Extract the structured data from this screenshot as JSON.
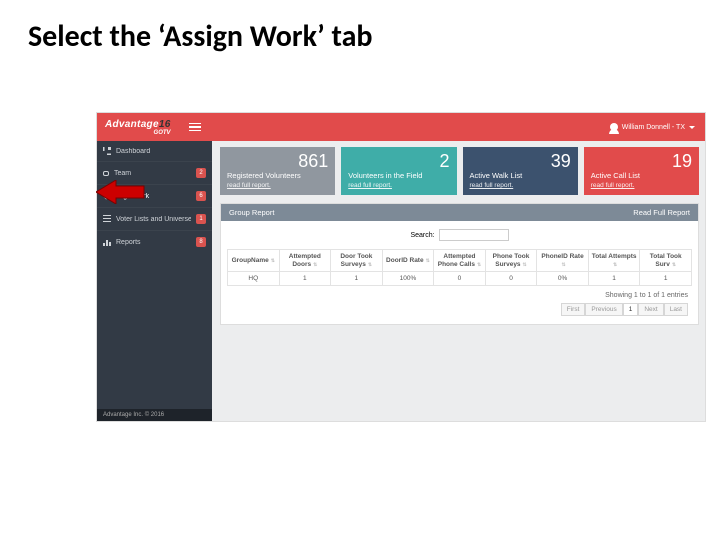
{
  "slide_title": "Select the ‘Assign Work’ tab",
  "topbar": {
    "logo_main": "Advantage",
    "logo_year": "16",
    "logo_sub": "GOTV",
    "user_label": "William Donnell - TX"
  },
  "sidebar": {
    "items": [
      {
        "label": "Dashboard",
        "badge": ""
      },
      {
        "label": "Team",
        "badge": "2"
      },
      {
        "label": "Assign Work",
        "badge": "6"
      },
      {
        "label": "Voter Lists and Universes",
        "badge": "1"
      },
      {
        "label": "Reports",
        "badge": "8"
      }
    ]
  },
  "footer": "Advantage Inc. © 2016",
  "cards": [
    {
      "value": "861",
      "title": "Registered Volunteers",
      "link": "read full report."
    },
    {
      "value": "2",
      "title": "Volunteers in the Field",
      "link": "read full report."
    },
    {
      "value": "39",
      "title": "Active Walk List",
      "link": "read full report."
    },
    {
      "value": "19",
      "title": "Active Call List",
      "link": "read full report."
    }
  ],
  "panel": {
    "title": "Group Report",
    "full_report": "Read Full Report",
    "search_label": "Search:",
    "columns": [
      "GroupName",
      "Attempted Doors",
      "Door Took Surveys",
      "DoorID Rate",
      "Attempted Phone Calls",
      "Phone Took Surveys",
      "PhoneID Rate",
      "Total Attempts",
      "Total Took Surv"
    ],
    "rows": [
      {
        "cells": [
          "HQ",
          "1",
          "1",
          "100%",
          "0",
          "0",
          "0%",
          "1",
          "1"
        ]
      }
    ],
    "entries": "Showing 1 to 1 of 1 entries",
    "pager": [
      "First",
      "Previous",
      "1",
      "Next",
      "Last"
    ]
  }
}
